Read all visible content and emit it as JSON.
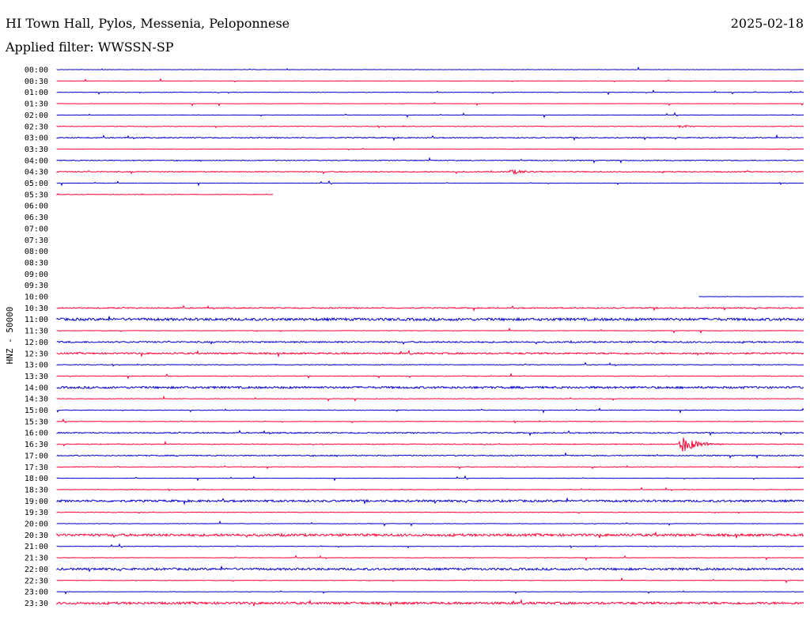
{
  "header": {
    "station": "HI Town Hall, Pylos, Messenia, Peloponnese",
    "date": "2025-02-18",
    "filter_text": "Applied filter: WWSSN-SP"
  },
  "colors": {
    "even_hour": "#0000cc",
    "odd_half_hour": "#ff0033"
  },
  "chart_data": {
    "type": "line",
    "ylabel": "HNZ - 50000",
    "row_labels": [
      "00:00",
      "00:30",
      "01:00",
      "01:30",
      "02:00",
      "02:30",
      "03:00",
      "03:30",
      "04:00",
      "04:30",
      "05:00",
      "05:30",
      "06:00",
      "06:30",
      "07:00",
      "07:30",
      "08:00",
      "08:30",
      "09:00",
      "09:30",
      "10:00",
      "10:30",
      "11:00",
      "11:30",
      "12:00",
      "12:30",
      "13:00",
      "13:30",
      "14:00",
      "14:30",
      "15:00",
      "15:30",
      "16:00",
      "16:30",
      "17:00",
      "17:30",
      "18:00",
      "18:30",
      "19:00",
      "19:30",
      "20:00",
      "20:30",
      "21:00",
      "21:30",
      "22:00",
      "22:30",
      "23:00",
      "23:30"
    ],
    "trace_coverage": [
      [
        0,
        1
      ],
      [
        0,
        1
      ],
      [
        0,
        1
      ],
      [
        0,
        1
      ],
      [
        0,
        1
      ],
      [
        0,
        1
      ],
      [
        0,
        1
      ],
      [
        0,
        1
      ],
      [
        0,
        1
      ],
      [
        0,
        1
      ],
      [
        0,
        1
      ],
      [
        0,
        0.29
      ],
      null,
      null,
      null,
      null,
      null,
      null,
      null,
      null,
      [
        0.86,
        1
      ],
      [
        0,
        1
      ],
      [
        0,
        1
      ],
      [
        0,
        1
      ],
      [
        0,
        1
      ],
      [
        0,
        1
      ],
      [
        0,
        1
      ],
      [
        0,
        1
      ],
      [
        0,
        1
      ],
      [
        0,
        1
      ],
      [
        0,
        1
      ],
      [
        0,
        1
      ],
      [
        0,
        1
      ],
      [
        0,
        1
      ],
      [
        0,
        1
      ],
      [
        0,
        1
      ],
      [
        0,
        1
      ],
      [
        0,
        1
      ],
      [
        0,
        1
      ],
      [
        0,
        1
      ],
      [
        0,
        1
      ],
      [
        0,
        1
      ],
      [
        0,
        1
      ],
      [
        0,
        1
      ],
      [
        0,
        1
      ],
      [
        0,
        1
      ],
      [
        0,
        1
      ],
      [
        0,
        1
      ]
    ],
    "noise_level": [
      0.2,
      0.2,
      0.3,
      0.2,
      0.2,
      0.3,
      0.6,
      0.2,
      0.5,
      0.6,
      0.2,
      0.3,
      0,
      0,
      0,
      0,
      0,
      0,
      0,
      0,
      0.2,
      0.7,
      1.6,
      0.3,
      0.9,
      1.0,
      0.4,
      0.4,
      1.3,
      0.3,
      0.4,
      0.3,
      0.7,
      0.5,
      0.6,
      0.4,
      0.2,
      0.3,
      1.3,
      0.3,
      0.3,
      1.5,
      0.3,
      0.3,
      1.3,
      0.3,
      0.2,
      1.4
    ],
    "events": [
      {
        "row": 5,
        "center": 0.835,
        "width": 0.03,
        "amplitude": 2
      },
      {
        "row": 9,
        "center": 0.61,
        "width": 0.05,
        "amplitude": 2.5
      },
      {
        "row": 11,
        "center": 0.113,
        "width": 0.004,
        "amplitude": 1.5
      },
      {
        "row": 33,
        "center": 0.838,
        "width": 0.055,
        "amplitude": 10
      }
    ]
  }
}
